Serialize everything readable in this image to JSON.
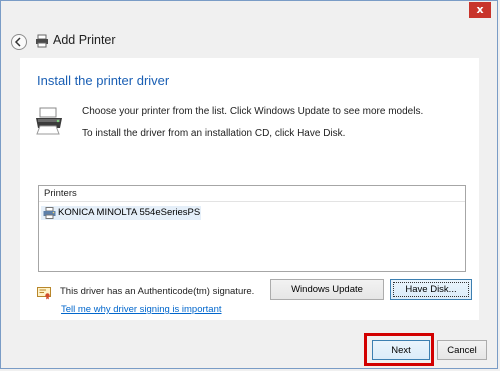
{
  "window": {
    "close_label": "x",
    "title": "Add Printer",
    "heading": "Install the printer driver",
    "instruction_1": "Choose your printer from the list. Click Windows Update to see more models.",
    "instruction_2": "To install the driver from an installation CD, click Have Disk."
  },
  "printers": {
    "header": "Printers",
    "items": [
      {
        "label": "KONICA MINOLTA 554eSeriesPS",
        "selected": true
      }
    ]
  },
  "signature": {
    "text": "This driver has an Authenticode(tm) signature.",
    "link": "Tell me why driver signing is important"
  },
  "buttons": {
    "windows_update": "Windows Update",
    "have_disk": "Have Disk...",
    "next": "Next",
    "cancel": "Cancel"
  },
  "colors": {
    "heading": "#1a5fb4",
    "link": "#0066cc",
    "highlight_box": "#d20000",
    "close_button": "#c8342b"
  }
}
